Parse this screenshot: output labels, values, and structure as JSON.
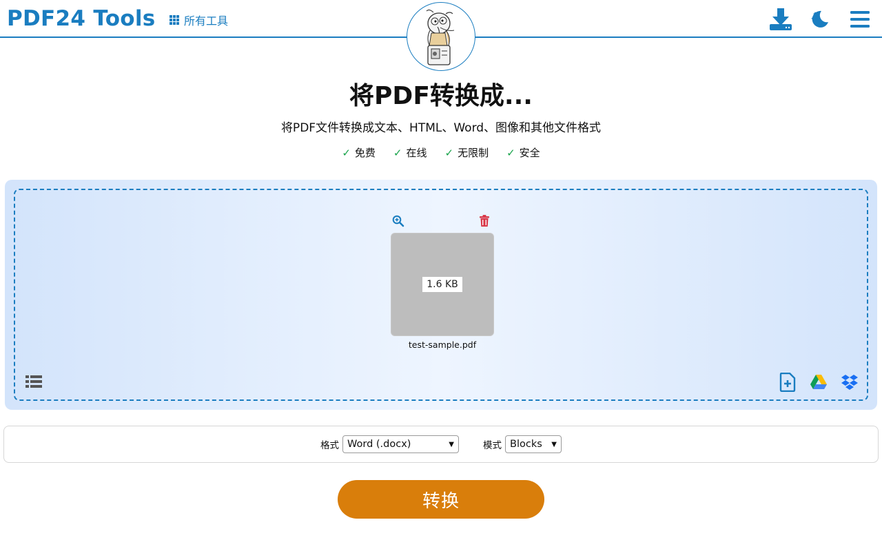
{
  "header": {
    "brand": "PDF24 Tools",
    "all_tools": "所有工具",
    "icons": [
      "download-icon",
      "dark-mode-icon",
      "menu-icon"
    ]
  },
  "hero": {
    "title": "将PDF转换成...",
    "subtitle": "将PDF文件转换成文本、HTML、Word、图像和其他文件格式",
    "features": [
      "免费",
      "在线",
      "无限制",
      "安全"
    ]
  },
  "file": {
    "size": "1.6 KB",
    "name": "test-sample.pdf"
  },
  "options": {
    "format_label": "格式",
    "format_value": "Word (.docx)",
    "mode_label": "模式",
    "mode_value": "Blocks"
  },
  "convert_label": "转换",
  "colors": {
    "brand": "#1a7dc0",
    "convert": "#d97e0b",
    "check": "#18a34a",
    "delete": "#d9394a"
  }
}
